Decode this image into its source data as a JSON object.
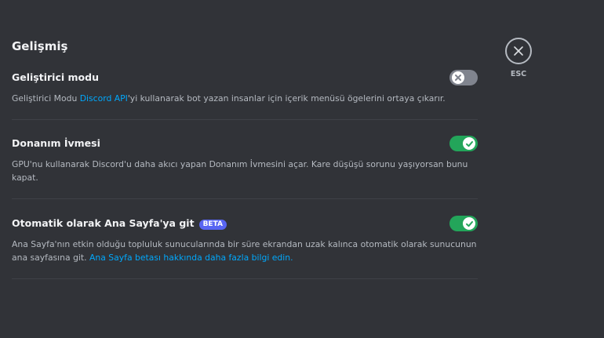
{
  "page": {
    "title": "Gelişmiş",
    "esc_label": "ESC"
  },
  "settings": [
    {
      "title": "Geliştirici modu",
      "enabled": false,
      "desc_before": "Geliştirici Modu ",
      "desc_link": "Discord API",
      "desc_after": "'yi kullanarak bot yazan insanlar için içerik menüsü ögelerini ortaya çıkarır."
    },
    {
      "title": "Donanım İvmesi",
      "enabled": true,
      "desc_before": "GPU'nu kullanarak Discord'u daha akıcı yapan Donanım İvmesini açar. Kare düşüşü sorunu yaşıyorsan bunu kapat."
    },
    {
      "title": "Otomatik olarak Ana Sayfa'ya git",
      "badge": "BETA",
      "enabled": true,
      "desc_before": "Ana Sayfa'nın etkin olduğu topluluk sunucularında bir süre ekrandan uzak kalınca otomatik olarak sunucunun ana sayfasına git. ",
      "desc_link": "Ana Sayfa betası hakkında daha fazla bilgi edin."
    }
  ],
  "colors": {
    "toggle_on": "#23a55a",
    "toggle_off": "#80848e",
    "link": "#00a8fc",
    "badge": "#5865f2"
  }
}
